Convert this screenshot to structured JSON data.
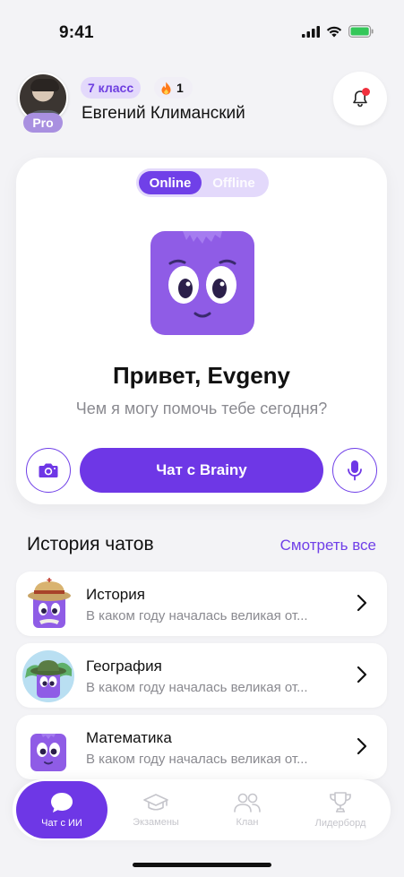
{
  "status_bar": {
    "time": "9:41"
  },
  "header": {
    "badge_pro": "Pro",
    "class_label": "7 класс",
    "streak_count": "1",
    "user_name": "Евгений Климанский"
  },
  "main_card": {
    "mode_online": "Online",
    "mode_offline": "Offline",
    "greeting": "Привет, Evgeny",
    "subtitle": "Чем я могу помочь тебе сегодня?",
    "chat_button_label": "Чат с Brainy"
  },
  "history": {
    "title": "История чатов",
    "see_all": "Смотреть все",
    "items": [
      {
        "title": "История",
        "preview": "В каком году началась великая от..."
      },
      {
        "title": "География",
        "preview": "В каком году началась великая от..."
      },
      {
        "title": "Математика",
        "preview": "В каком году началась великая от..."
      }
    ]
  },
  "tabs": [
    {
      "label": "Чат с ИИ"
    },
    {
      "label": "Экзамены"
    },
    {
      "label": "Клан"
    },
    {
      "label": "Лидерборд"
    }
  ],
  "colors": {
    "accent": "#6e37e6",
    "accent_light": "#e3d9fb",
    "notification": "#f0303d",
    "battery": "#34c759"
  }
}
